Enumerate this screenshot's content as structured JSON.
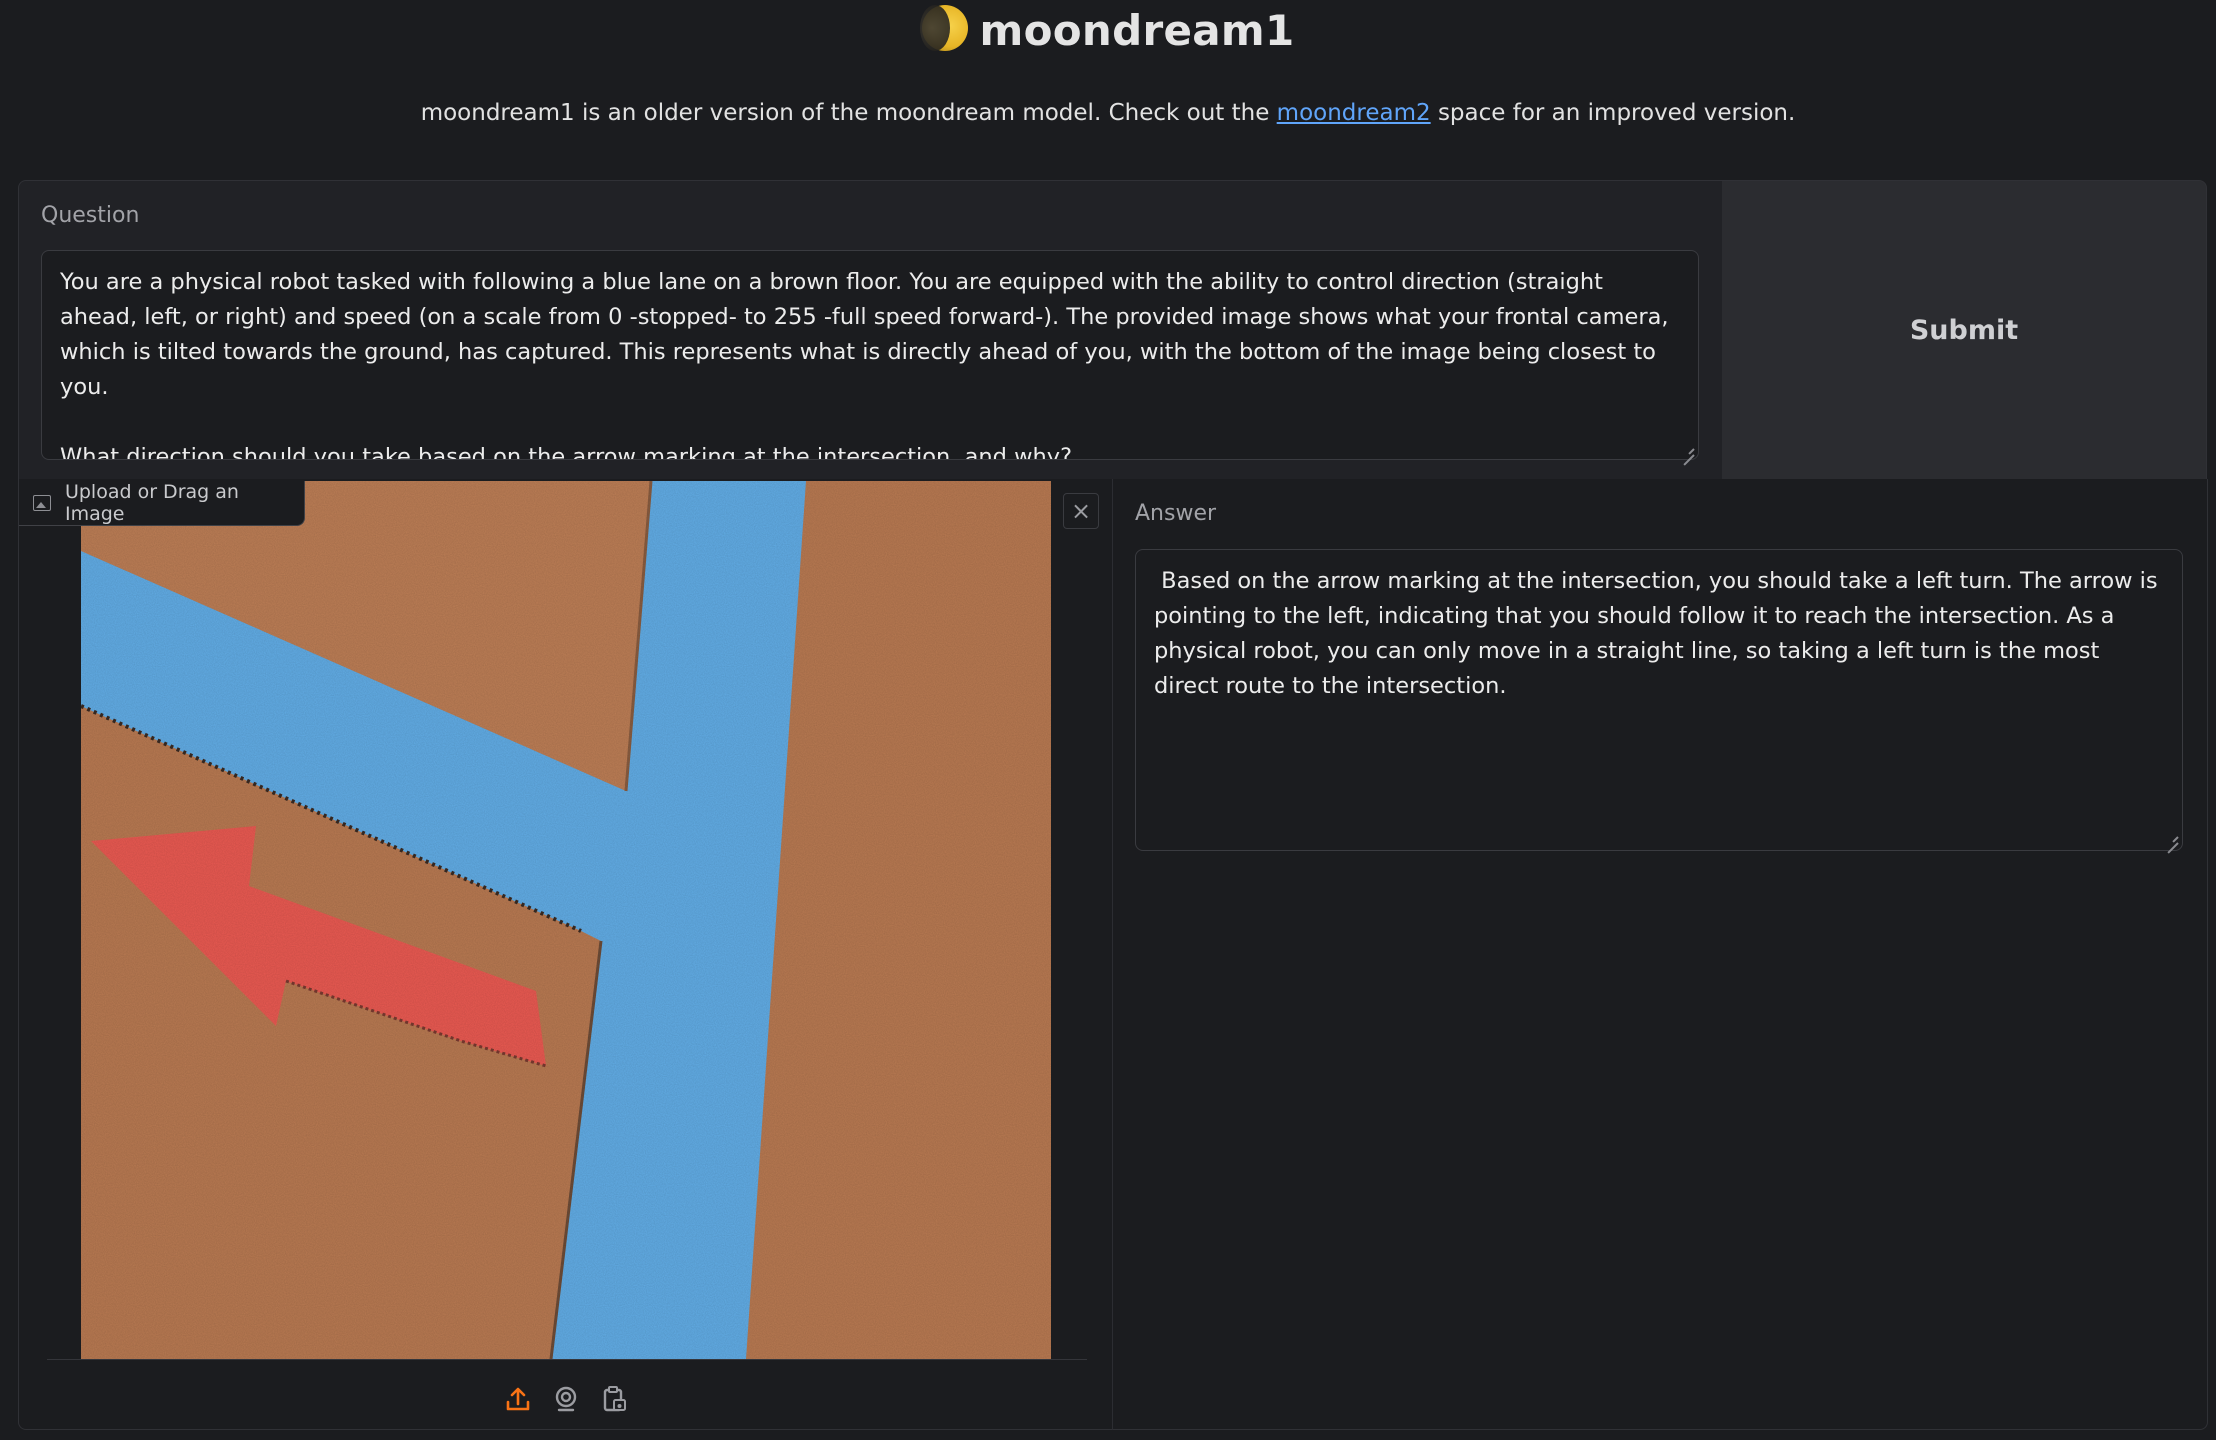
{
  "header": {
    "title": "moondream1",
    "icon": "moon-icon",
    "subtitle_before": "moondream1 is an older version of the moondream model. Check out the ",
    "subtitle_link": "moondream2",
    "subtitle_after": " space for an improved version."
  },
  "question": {
    "label": "Question",
    "value": "You are a physical robot tasked with following a blue lane on a brown floor. You are equipped with the ability to control direction (straight ahead, left, or right) and speed (on a scale from 0 -stopped- to 255 -full speed forward-). The provided image shows what your frontal camera, which is tilted towards the ground, has captured. This represents what is directly ahead of you, with the bottom of the image being closest to you.\n\nWhat direction should you take based on the arrow marking at the intersection, and why?"
  },
  "submit": {
    "label": "Submit"
  },
  "image_input": {
    "label": "Upload or Drag an Image",
    "toolbar_icons": [
      "upload-icon",
      "webcam-icon",
      "clipboard-icon"
    ],
    "accent_color": "#f97316"
  },
  "answer": {
    "label": "Answer",
    "value": " Based on the arrow marking at the intersection, you should take a left turn. The arrow is pointing to the left, indicating that you should follow it to reach the intersection. As a physical robot, you can only move in a straight line, so taking a left turn is the most direct route to the intersection."
  },
  "colors": {
    "background": "#1b1c1f",
    "panel": "#212226",
    "submit_panel": "#2b2c30",
    "link": "#60a5fa",
    "floor": "#b87a52",
    "lane": "#62ade6",
    "arrow": "#e9564f"
  }
}
